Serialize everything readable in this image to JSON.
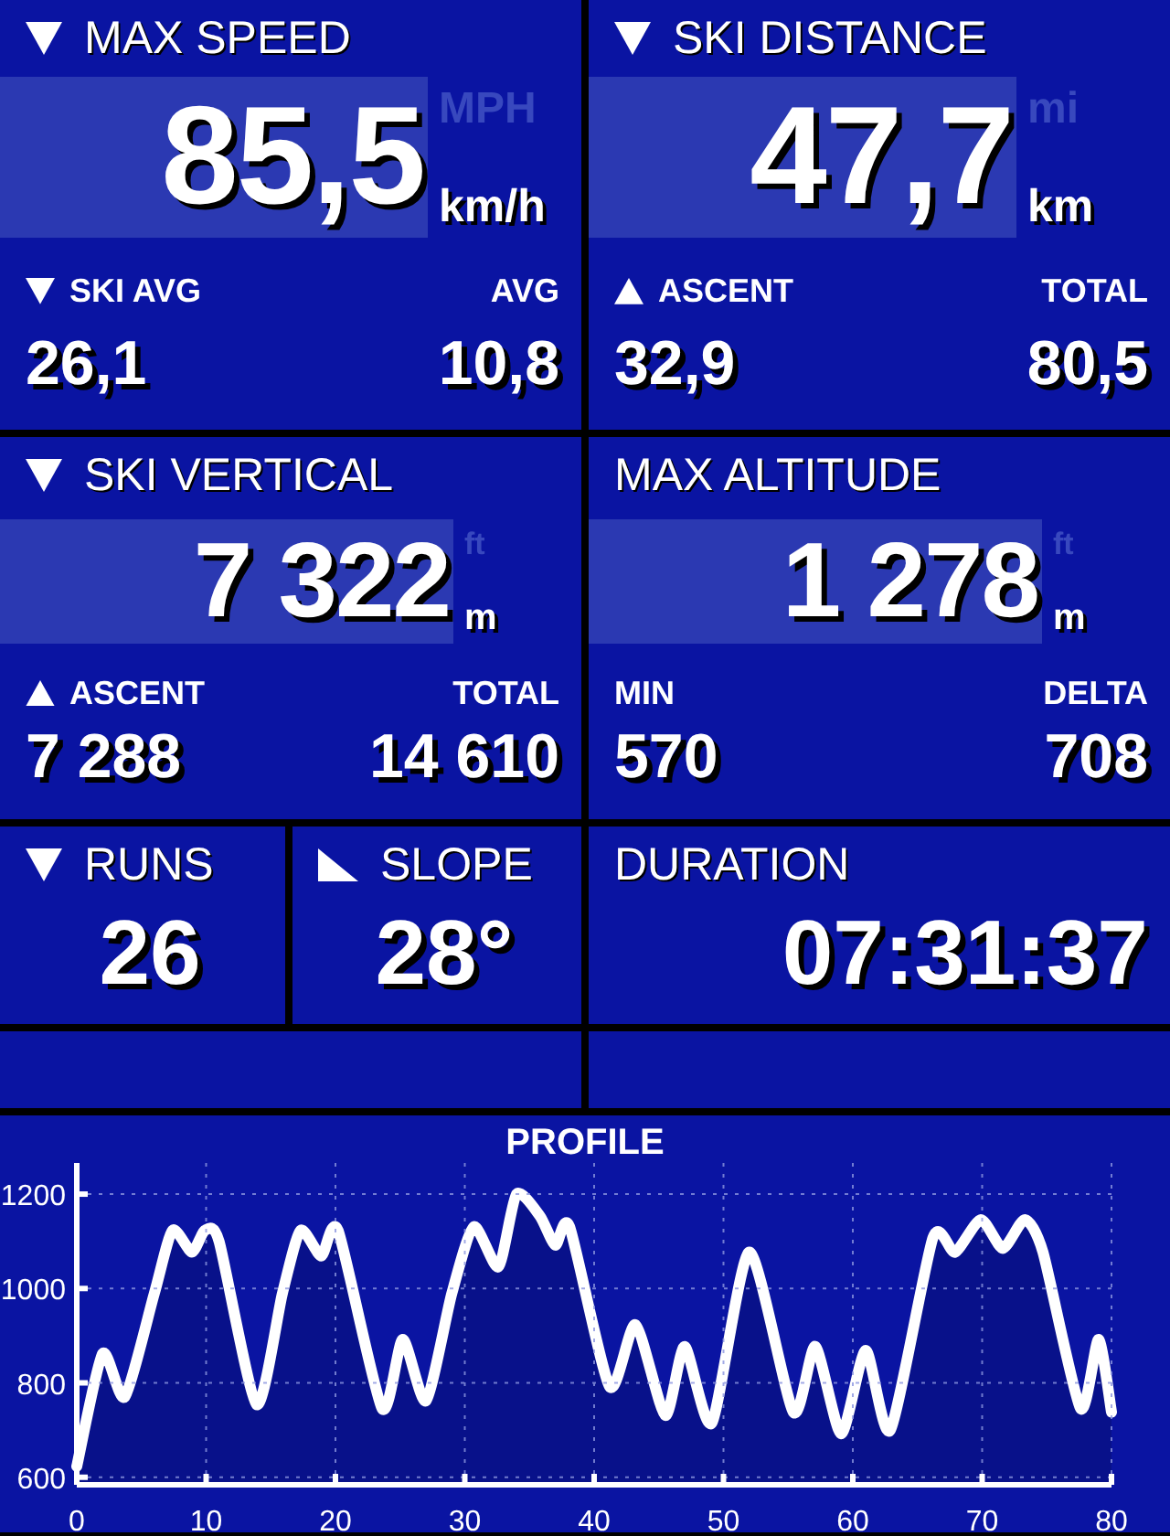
{
  "tiles": [
    {
      "kind": "big",
      "title": "MAX SPEED",
      "icon": {
        "kind": "down"
      },
      "value": "85,5",
      "unit": "km/h",
      "alt_unit": "MPH",
      "stats": [
        {
          "label": "SKI AVG",
          "icon": {
            "kind": "down"
          },
          "value": "26,1"
        },
        {
          "label": "AVG",
          "value": "10,8"
        }
      ]
    },
    {
      "kind": "big",
      "title": "SKI DISTANCE",
      "icon": {
        "kind": "down"
      },
      "value": "47,7",
      "unit": "km",
      "alt_unit": "mi",
      "stats": [
        {
          "label": "ASCENT",
          "icon": {
            "kind": "up"
          },
          "value": "32,9"
        },
        {
          "label": "TOTAL",
          "value": "80,5"
        }
      ]
    },
    {
      "kind": "big",
      "title": "SKI VERTICAL",
      "icon": {
        "kind": "down"
      },
      "value": "7 322",
      "unit": "m",
      "alt_unit": "ft",
      "stats": [
        {
          "label": "ASCENT",
          "icon": {
            "kind": "up"
          },
          "value": "7 288"
        },
        {
          "label": "TOTAL",
          "value": "14 610"
        }
      ]
    },
    {
      "kind": "big",
      "title": "MAX ALTITUDE",
      "value": "1 278",
      "unit": "m",
      "alt_unit": "ft",
      "stats": [
        {
          "label": "MIN",
          "value": "570"
        },
        {
          "label": "DELTA",
          "value": "708"
        }
      ]
    },
    {
      "kind": "small",
      "title": "RUNS",
      "icon": {
        "kind": "down"
      },
      "value": "26"
    },
    {
      "kind": "small",
      "title": "SLOPE",
      "icon": {
        "kind": "slope"
      },
      "value": "28°"
    },
    {
      "kind": "wide",
      "title": "DURATION",
      "value": "07:31:37"
    },
    {
      "kind": "empty"
    },
    {
      "kind": "empty"
    }
  ],
  "profile": {
    "chart_data": {
      "type": "area",
      "title": "PROFILE",
      "grid": true,
      "xlim": [
        0,
        80
      ],
      "ylim": [
        584,
        1266
      ],
      "xticks": [
        0,
        10,
        20,
        30,
        40,
        50,
        60,
        70,
        80
      ],
      "yticks": [
        600,
        800,
        1000,
        1200
      ],
      "x": [
        0,
        2,
        3.7,
        6,
        7.4,
        8.9,
        9.9,
        11,
        13.9,
        15.9,
        17.3,
        18.9,
        20.2,
        23.6,
        25.2,
        27,
        29,
        30.7,
        32.6,
        34,
        35.8,
        37,
        38.1,
        41.2,
        43.2,
        45.5,
        47,
        49.1,
        52,
        55.4,
        57.1,
        59.1,
        61,
        62.9,
        66.2,
        67.9,
        69.9,
        71.6,
        73.3,
        74.7,
        77.6,
        79,
        80
      ],
      "series": [
        {
          "color": "#ffffff",
          "values": [
            623,
            862,
            770,
            990,
            1123,
            1077,
            1123,
            1100,
            754,
            990,
            1123,
            1069,
            1123,
            746,
            892,
            762,
            990,
            1131,
            1046,
            1200,
            1154,
            1092,
            1131,
            792,
            923,
            731,
            877,
            715,
            1077,
            738,
            877,
            692,
            869,
            700,
            1108,
            1077,
            1146,
            1085,
            1146,
            1077,
            746,
            892,
            738
          ]
        }
      ]
    }
  }
}
